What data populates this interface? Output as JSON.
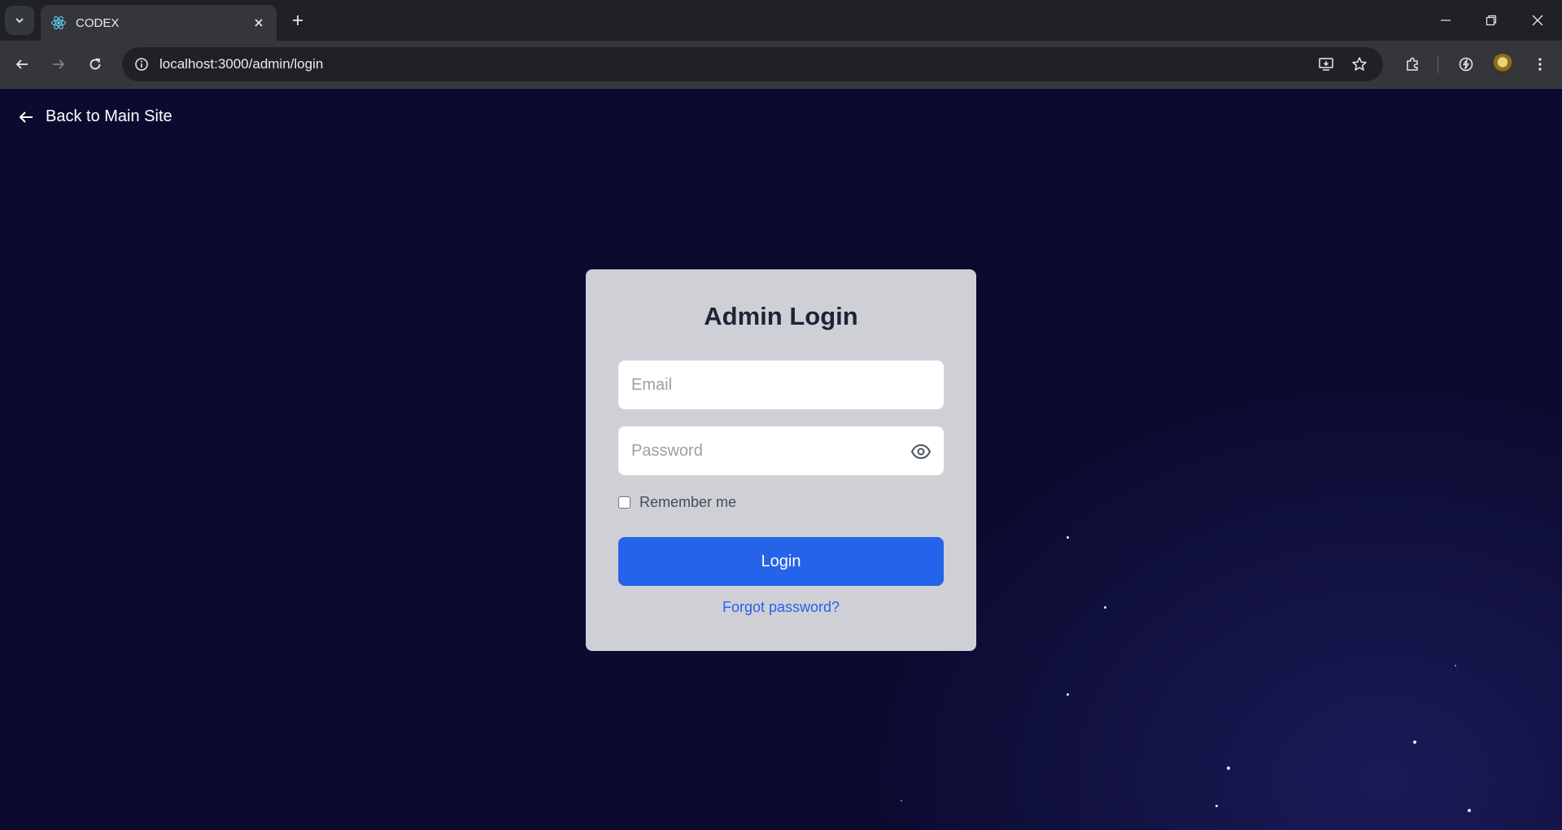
{
  "browser": {
    "tab_title": "CODEX",
    "url": "localhost:3000/admin/login"
  },
  "page": {
    "back_link": "Back to Main Site",
    "card": {
      "title": "Admin Login",
      "email_placeholder": "Email",
      "password_placeholder": "Password",
      "remember_label": "Remember me",
      "login_label": "Login",
      "forgot_label": "Forgot password?"
    }
  },
  "colors": {
    "background": "#0b0b30",
    "card": "#cfcfd6",
    "primary": "#2563eb",
    "title": "#1c2536"
  }
}
